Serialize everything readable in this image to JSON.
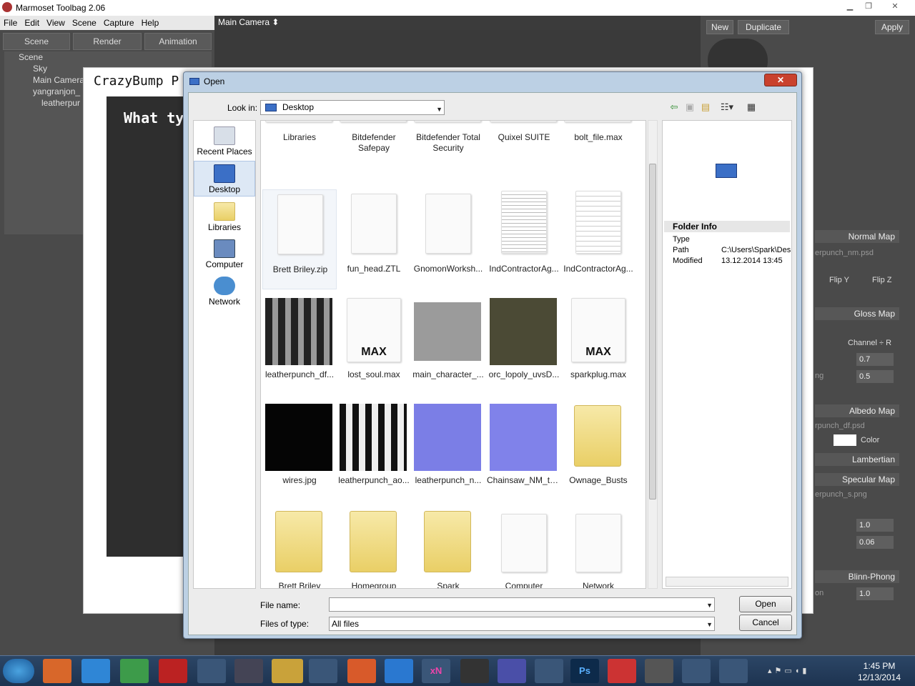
{
  "app": {
    "title": "Marmoset Toolbag 2.06",
    "camera": "Main Camera ⬍",
    "menu": [
      "File",
      "Edit",
      "View",
      "Scene",
      "Capture",
      "Help"
    ],
    "tabs": [
      "Scene",
      "Render",
      "Animation"
    ],
    "tree": [
      "Scene",
      "Sky",
      "Main Camera",
      "yangranjon_",
      "leatherpur"
    ]
  },
  "right_panel": {
    "new": "New",
    "duplicate": "Duplicate",
    "apply": "Apply",
    "sections": [
      "Normal Map",
      "Gloss Map",
      "Albedo Map",
      "Lambertian",
      "Specular Map",
      "Blinn-Phong"
    ],
    "normal_file": "erpunch_nm.psd",
    "flip_y": "Flip Y",
    "flip_z": "Flip Z",
    "channel": "Channel ÷ R",
    "gloss_val1": "0.7",
    "gloss_label2": "ng",
    "gloss_val2": "0.5",
    "albedo_file": "rpunch_df.psd",
    "color": "Color",
    "spec_file": "erpunch_s.png",
    "spec_val1": "1.0",
    "spec_val2": "0.06",
    "blinn_label": "on",
    "blinn_val": "1.0"
  },
  "crazybump": {
    "title": "CrazyBump P",
    "prompt": "What ty"
  },
  "dialog": {
    "title": "Open",
    "look_in_label": "Look in:",
    "look_in_value": "Desktop",
    "places": [
      "Recent Places",
      "Desktop",
      "Libraries",
      "Computer",
      "Network"
    ],
    "files": [
      "Libraries",
      "Bitdefender Safepay",
      "Bitdefender Total Security",
      "Quixel SUITE",
      "bolt_file.max",
      "Brett Briley.zip",
      "fun_head.ZTL",
      "GnomonWorksh...",
      "IndContractorAg...",
      "IndContractorAg...",
      "leatherpunch_df...",
      "lost_soul.max",
      "main_character_...",
      "orc_lopoly_uvsD...",
      "sparkplug.max",
      "wires.jpg",
      "leatherpunch_ao...",
      "leatherpunch_n...",
      "Chainsaw_NM_te...",
      "Ownage_Busts",
      "Brett Briley",
      "Homegroup",
      "Spark",
      "Computer",
      "Network"
    ],
    "max_label": "MAX",
    "folder_info_title": "Folder Info",
    "info_labels": [
      "Type",
      "Path",
      "Modified"
    ],
    "info_path": "C:\\Users\\Spark\\Des",
    "info_modified": "13.12.2014 13:45",
    "file_name_label": "File name:",
    "file_name_value": "",
    "files_of_type_label": "Files of type:",
    "files_of_type_value": "All files",
    "open_button": "Open",
    "cancel_button": "Cancel"
  },
  "taskbar": {
    "time": "1:45 PM",
    "date": "12/13/2014",
    "xn": "xN",
    "ps": "Ps"
  }
}
